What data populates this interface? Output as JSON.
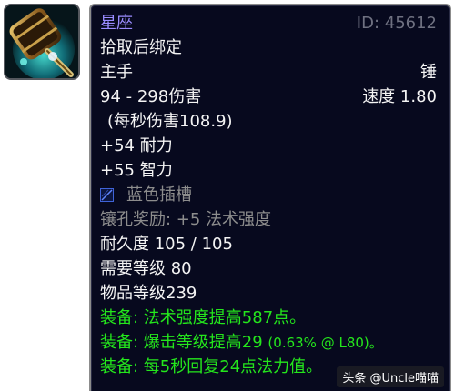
{
  "item": {
    "name": "星座",
    "id_label": "ID: 45612",
    "binding": "拾取后绑定",
    "slot": "主手",
    "weapon_type": "锤",
    "damage": "94 - 298伤害",
    "speed": "速度 1.80",
    "dps": "(每秒伤害108.9)",
    "stat_stamina": "+54 耐力",
    "stat_intellect": "+55 智力",
    "socket_label": "蓝色插槽",
    "socket_bonus": "镶孔奖励: +5 法术强度",
    "durability": "耐久度 105 / 105",
    "required_level": "需要等级 80",
    "item_level": "物品等级239",
    "equip_1": "装备:  法术强度提高587点。",
    "equip_2_text": "装备:  爆击等级提高29 ",
    "equip_2_pct": "(0.63% @ L80)。",
    "equip_3": "装备:  每5秒回复24点法力值。"
  },
  "icon": {
    "item_icon": "mace-icon",
    "socket_icon": "blue-socket-icon"
  },
  "watermark": "头条 @Uncle喵喵",
  "colors": {
    "tooltip_bg": "#07091e",
    "epic_name": "#9a8cff",
    "equip_green": "#24e61c",
    "grey_text": "#8d8d8d",
    "socket_blue": "#3f63d8"
  }
}
